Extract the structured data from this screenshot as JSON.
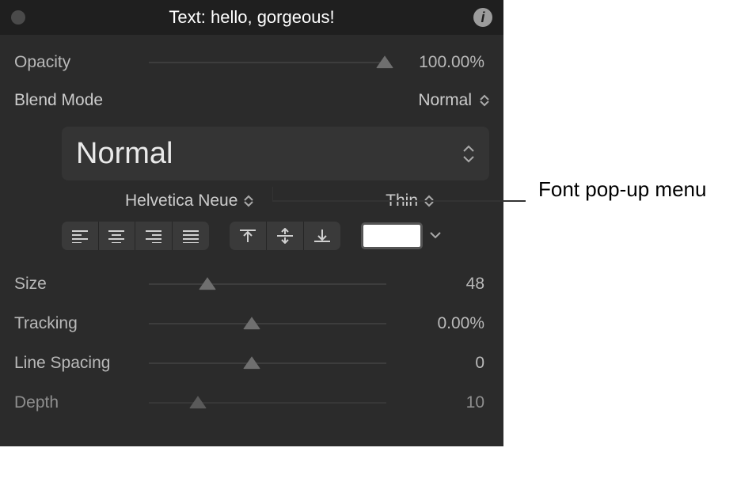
{
  "title": "Text: hello, gorgeous!",
  "callout": "Font pop-up menu",
  "controls": {
    "opacity": {
      "label": "Opacity",
      "value": "100.00%",
      "thumb_pct": 96
    },
    "blend_mode": {
      "label": "Blend Mode",
      "value": "Normal"
    },
    "preset": {
      "value": "Normal"
    },
    "font": {
      "value": "Helvetica Neue"
    },
    "weight": {
      "value": "Thin"
    },
    "size": {
      "label": "Size",
      "value": "48",
      "thumb_pct": 24
    },
    "tracking": {
      "label": "Tracking",
      "value": "0.00%",
      "thumb_pct": 42
    },
    "line_spacing": {
      "label": "Line Spacing",
      "value": "0",
      "thumb_pct": 42
    },
    "depth": {
      "label": "Depth",
      "value": "10",
      "thumb_pct": 20
    }
  },
  "icons": {
    "info": "i"
  },
  "colors": {
    "text_color": "#ffffff"
  }
}
